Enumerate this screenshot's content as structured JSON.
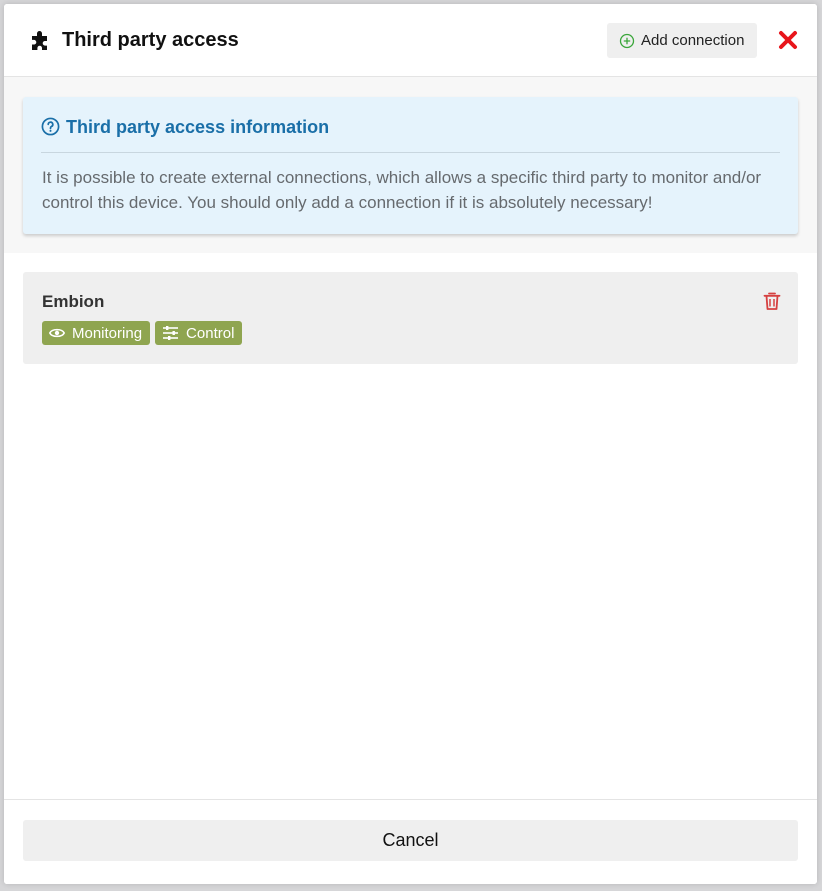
{
  "dialog": {
    "title": "Third party access",
    "title_icon": "puzzle-piece-icon",
    "add_connection_label": "Add connection",
    "add_icon": "plus-circle-icon",
    "close_icon": "close-icon",
    "close_color": "#e8151b"
  },
  "info": {
    "title": "Third party access information",
    "icon": "question-circle-icon",
    "text": "It is possible to create external connections, which allows a specific third party to monitor and/or control this device. You should only add a connection if it is absolutely necessary!",
    "title_color": "#1a6fa8",
    "background_color": "#e5f3fc"
  },
  "connections": [
    {
      "name": "Embion",
      "delete_icon": "trash-icon",
      "tags": [
        {
          "label": "Monitoring",
          "icon": "eye-icon"
        },
        {
          "label": "Control",
          "icon": "sliders-icon"
        }
      ]
    }
  ],
  "tag_color": "#8fa550",
  "delete_color": "#d64040",
  "footer": {
    "cancel_label": "Cancel"
  }
}
